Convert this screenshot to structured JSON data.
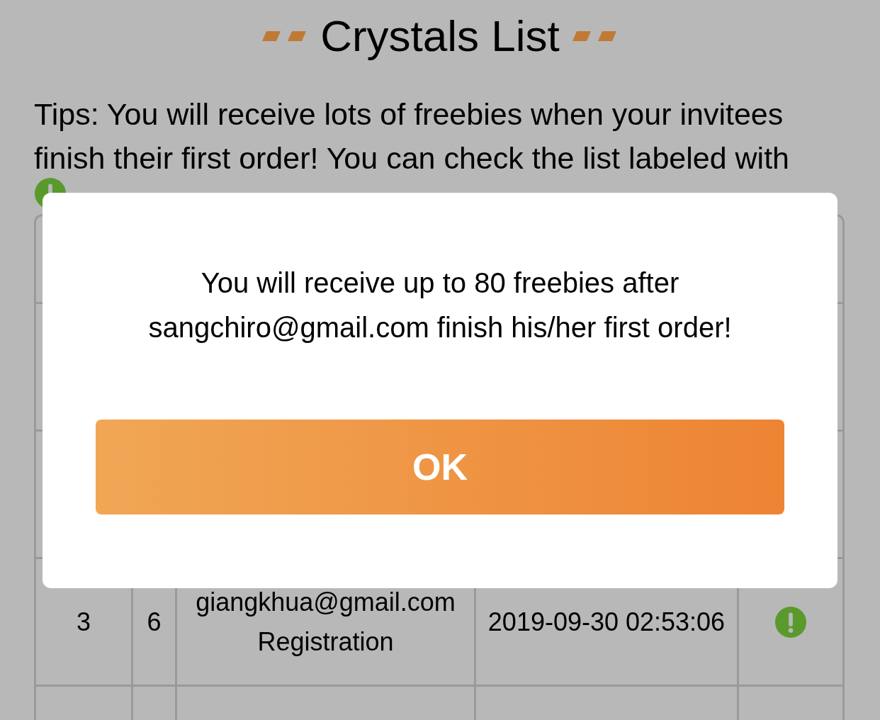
{
  "title": "Crystals List",
  "tips": "Tips: You will receive lots of freebies when your invitees finish their first order! You can check the list labeled with",
  "table": {
    "rows": [
      {
        "rank": "3",
        "crystals": "6",
        "email": "giangkhua@gmail.com",
        "type": "Registration",
        "time": "2019-09-30 02:53:06",
        "pending": true
      }
    ]
  },
  "dialog": {
    "message": "You will receive up to 80 freebies after sangchiro@gmail.com finish his/her first order!",
    "button": "OK"
  }
}
